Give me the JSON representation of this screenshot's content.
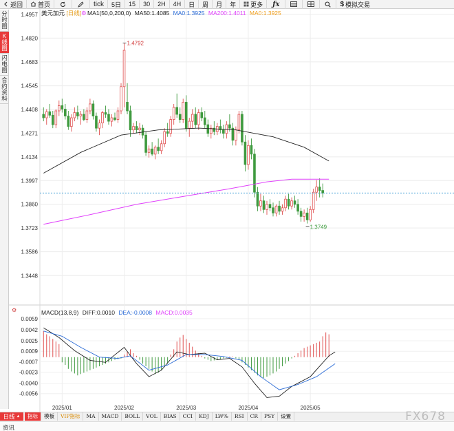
{
  "toolbar": {
    "items": [
      {
        "label": "返回",
        "icon": "back-arrow-icon"
      },
      {
        "label": "首页",
        "icon": "home-icon"
      },
      {
        "label": "",
        "icon": "refresh-icon"
      },
      {
        "label": "",
        "icon": "draw-pen-icon"
      },
      {
        "label": "tick"
      },
      {
        "label": "5日"
      },
      {
        "label": "15"
      },
      {
        "label": "30"
      },
      {
        "label": "2H"
      },
      {
        "label": "4H"
      },
      {
        "label": "日"
      },
      {
        "label": "周"
      },
      {
        "label": "月"
      },
      {
        "label": "年"
      },
      {
        "label": "更多",
        "icon": "grid-icon"
      },
      {
        "label": "",
        "icon": "function-fx-icon"
      },
      {
        "label": "",
        "icon": "list-icon"
      },
      {
        "label": "",
        "icon": "multi-window-icon"
      },
      {
        "label": "",
        "icon": "search-icon"
      },
      {
        "label": "模拟交易",
        "icon": "dollar-icon"
      }
    ]
  },
  "sidebar": {
    "tabs": [
      {
        "label": "分时图",
        "active": false
      },
      {
        "label": "K线图",
        "active": true
      },
      {
        "label": "闪电图",
        "active": false
      },
      {
        "label": "合约资料",
        "active": false
      }
    ]
  },
  "legend": {
    "symbol": "美元加元",
    "period": "[日线]",
    "ma_params": "MA1(50,0,200,0)",
    "ma50": "MA50:1.4085",
    "ma0a": "MA0:1.3925",
    "ma200": "MA200:1.4011",
    "ma0b": "MA0:1.3925",
    "colors": {
      "ma50": "#222222",
      "ma200": "#e040fb",
      "ma0a": "#2a6bd6",
      "ma0b": "#f0a020"
    }
  },
  "macd_legend": {
    "name": "MACD(13,8,9)",
    "diff": "DIFF:0.0010",
    "dea": "DEA:-0.0008",
    "macd": "MACD:0.0035",
    "colors": {
      "diff": "#222222",
      "dea": "#2a6bd6",
      "macd": "#e040fb"
    }
  },
  "annotations": {
    "high": "1.4792",
    "low": "1.3749"
  },
  "chart_data": {
    "type": "candlestick",
    "price_axis_ticks": [
      "1.4957",
      "1.4820",
      "1.4683",
      "1.4545",
      "1.4408",
      "1.4271",
      "1.4134",
      "1.3997",
      "1.3860",
      "1.3723",
      "1.3586",
      "1.3448"
    ],
    "price_range": [
      1.331,
      1.4957
    ],
    "current_price_line": 1.3925,
    "x_labels": [
      "2025/01",
      "2025/02",
      "2025/03",
      "2025/04",
      "2025/05"
    ],
    "x_label_positions": [
      6,
      26,
      46,
      66,
      86
    ],
    "n_bars": 98,
    "macd_axis_ticks": [
      "0.0059",
      "0.0042",
      "0.0025",
      "0.0009",
      "-0.0007",
      "-0.0023",
      "-0.0040",
      "-0.0056"
    ],
    "macd_range": [
      -0.007,
      0.0062
    ],
    "candles": [
      [
        1.438,
        1.442,
        1.434,
        1.436
      ],
      [
        1.436,
        1.441,
        1.432,
        1.4395
      ],
      [
        1.4395,
        1.444,
        1.436,
        1.4375
      ],
      [
        1.4375,
        1.44,
        1.43,
        1.432
      ],
      [
        1.432,
        1.441,
        1.43,
        1.44
      ],
      [
        1.44,
        1.446,
        1.437,
        1.443
      ],
      [
        1.443,
        1.447,
        1.439,
        1.441
      ],
      [
        1.441,
        1.444,
        1.435,
        1.437
      ],
      [
        1.437,
        1.44,
        1.429,
        1.431
      ],
      [
        1.431,
        1.438,
        1.428,
        1.436
      ],
      [
        1.436,
        1.442,
        1.434,
        1.439
      ],
      [
        1.439,
        1.443,
        1.435,
        1.437
      ],
      [
        1.437,
        1.44,
        1.432,
        1.438
      ],
      [
        1.438,
        1.441,
        1.434,
        1.435
      ],
      [
        1.435,
        1.442,
        1.433,
        1.44
      ],
      [
        1.44,
        1.447,
        1.438,
        1.444
      ],
      [
        1.444,
        1.446,
        1.435,
        1.437
      ],
      [
        1.437,
        1.439,
        1.428,
        1.43
      ],
      [
        1.43,
        1.435,
        1.426,
        1.433
      ],
      [
        1.433,
        1.44,
        1.43,
        1.439
      ],
      [
        1.439,
        1.443,
        1.436,
        1.438
      ],
      [
        1.438,
        1.441,
        1.432,
        1.434
      ],
      [
        1.434,
        1.438,
        1.431,
        1.436
      ],
      [
        1.436,
        1.439,
        1.434,
        1.435
      ],
      [
        1.435,
        1.442,
        1.433,
        1.44
      ],
      [
        1.44,
        1.456,
        1.438,
        1.454
      ],
      [
        1.454,
        1.4792,
        1.442,
        1.475
      ],
      [
        1.445,
        1.456,
        1.438,
        1.44
      ],
      [
        1.44,
        1.443,
        1.425,
        1.429
      ],
      [
        1.429,
        1.433,
        1.427,
        1.431
      ],
      [
        1.431,
        1.434,
        1.427,
        1.429
      ],
      [
        1.429,
        1.433,
        1.426,
        1.43
      ],
      [
        1.43,
        1.432,
        1.424,
        1.426
      ],
      [
        1.426,
        1.428,
        1.414,
        1.416
      ],
      [
        1.416,
        1.42,
        1.413,
        1.418
      ],
      [
        1.418,
        1.422,
        1.414,
        1.415
      ],
      [
        1.415,
        1.42,
        1.412,
        1.419
      ],
      [
        1.419,
        1.424,
        1.415,
        1.417
      ],
      [
        1.417,
        1.423,
        1.415,
        1.421
      ],
      [
        1.421,
        1.43,
        1.419,
        1.428
      ],
      [
        1.428,
        1.433,
        1.425,
        1.427
      ],
      [
        1.427,
        1.437,
        1.425,
        1.435
      ],
      [
        1.435,
        1.444,
        1.432,
        1.442
      ],
      [
        1.442,
        1.45,
        1.436,
        1.438
      ],
      [
        1.438,
        1.442,
        1.433,
        1.435
      ],
      [
        1.435,
        1.447,
        1.433,
        1.445
      ],
      [
        1.445,
        1.449,
        1.428,
        1.43
      ],
      [
        1.43,
        1.436,
        1.425,
        1.434
      ],
      [
        1.434,
        1.441,
        1.43,
        1.438
      ],
      [
        1.438,
        1.442,
        1.43,
        1.432
      ],
      [
        1.432,
        1.441,
        1.429,
        1.439
      ],
      [
        1.439,
        1.442,
        1.434,
        1.436
      ],
      [
        1.436,
        1.44,
        1.43,
        1.432
      ],
      [
        1.432,
        1.435,
        1.425,
        1.427
      ],
      [
        1.427,
        1.432,
        1.424,
        1.43
      ],
      [
        1.43,
        1.434,
        1.426,
        1.428
      ],
      [
        1.428,
        1.433,
        1.426,
        1.431
      ],
      [
        1.431,
        1.435,
        1.427,
        1.429
      ],
      [
        1.429,
        1.432,
        1.424,
        1.427
      ],
      [
        1.427,
        1.434,
        1.424,
        1.432
      ],
      [
        1.432,
        1.438,
        1.428,
        1.43
      ],
      [
        1.43,
        1.433,
        1.42,
        1.423
      ],
      [
        1.423,
        1.431,
        1.42,
        1.429
      ],
      [
        1.429,
        1.44,
        1.427,
        1.438
      ],
      [
        1.438,
        1.44,
        1.42,
        1.422
      ],
      [
        1.422,
        1.426,
        1.405,
        1.409
      ],
      [
        1.409,
        1.423,
        1.406,
        1.42
      ],
      [
        1.42,
        1.424,
        1.412,
        1.415
      ],
      [
        1.415,
        1.418,
        1.39,
        1.393
      ],
      [
        1.393,
        1.396,
        1.382,
        1.385
      ],
      [
        1.385,
        1.392,
        1.382,
        1.388
      ],
      [
        1.388,
        1.391,
        1.381,
        1.383
      ],
      [
        1.383,
        1.388,
        1.38,
        1.386
      ],
      [
        1.386,
        1.389,
        1.382,
        1.384
      ],
      [
        1.384,
        1.387,
        1.379,
        1.381
      ],
      [
        1.381,
        1.386,
        1.379,
        1.385
      ],
      [
        1.385,
        1.388,
        1.38,
        1.382
      ],
      [
        1.382,
        1.386,
        1.38,
        1.384
      ],
      [
        1.384,
        1.391,
        1.382,
        1.389
      ],
      [
        1.389,
        1.392,
        1.383,
        1.385
      ],
      [
        1.385,
        1.39,
        1.383,
        1.388
      ],
      [
        1.388,
        1.391,
        1.384,
        1.386
      ],
      [
        1.386,
        1.389,
        1.38,
        1.382
      ],
      [
        1.382,
        1.384,
        1.376,
        1.379
      ],
      [
        1.379,
        1.383,
        1.376,
        1.381
      ],
      [
        1.381,
        1.384,
        1.3749,
        1.377
      ],
      [
        1.377,
        1.385,
        1.376,
        1.383
      ],
      [
        1.383,
        1.395,
        1.381,
        1.393
      ],
      [
        1.393,
        1.4,
        1.388,
        1.396
      ],
      [
        1.396,
        1.401,
        1.39,
        1.394
      ],
      [
        1.394,
        1.398,
        1.39,
        1.3925
      ]
    ],
    "ma50_points": [
      [
        0,
        1.404
      ],
      [
        12,
        1.416
      ],
      [
        25,
        1.426
      ],
      [
        37,
        1.429
      ],
      [
        50,
        1.43
      ],
      [
        62,
        1.429
      ],
      [
        74,
        1.425
      ],
      [
        84,
        1.419
      ],
      [
        92,
        1.411
      ]
    ],
    "ma200_points": [
      [
        0,
        1.3745
      ],
      [
        15,
        1.38
      ],
      [
        30,
        1.386
      ],
      [
        45,
        1.3905
      ],
      [
        60,
        1.395
      ],
      [
        72,
        1.399
      ],
      [
        80,
        1.4005
      ],
      [
        92,
        1.4005
      ]
    ],
    "macd_hist": [
      0.004,
      0.0035,
      0.0032,
      0.0028,
      0.0024,
      0.002,
      -0.0008,
      -0.0012,
      -0.0018,
      -0.0022,
      -0.0025,
      -0.0028,
      -0.0026,
      -0.0024,
      -0.0022,
      -0.002,
      -0.0018,
      -0.0016,
      -0.0014,
      -0.0012,
      -0.001,
      -0.0008,
      -0.0006,
      -0.0004,
      -0.0003,
      -0.0002,
      0.0004,
      0.0008,
      0.0012,
      0.0006,
      0.0002,
      -0.0004,
      -0.001,
      -0.0014,
      -0.0018,
      -0.0022,
      -0.0026,
      -0.0024,
      -0.002,
      -0.0015,
      -0.001,
      0.0004,
      0.0012,
      0.0024,
      0.003,
      0.0034,
      0.0028,
      0.0022,
      0.0016,
      0.001,
      0.0006,
      0.0002,
      -0.0002,
      -0.0004,
      -0.0006,
      -0.0005,
      -0.0004,
      -0.0003,
      -0.0002,
      -0.0001,
      0.0001,
      0.0001,
      -0.0002,
      -0.0004,
      -0.0008,
      -0.0012,
      -0.0016,
      -0.002,
      -0.0024,
      -0.0028,
      -0.003,
      -0.0032,
      -0.003,
      -0.0028,
      -0.0025,
      -0.0022,
      -0.0018,
      -0.0014,
      -0.001,
      -0.0006,
      -0.0002,
      0.0002,
      0.0006,
      0.001,
      0.0014,
      0.0016,
      0.0018,
      0.002,
      0.0022,
      0.0024,
      0.0032,
      0.0038,
      0.0035
    ],
    "diff_points": [
      [
        0,
        0.0045
      ],
      [
        5,
        0.003
      ],
      [
        10,
        0.001
      ],
      [
        15,
        -0.0005
      ],
      [
        20,
        -0.0008
      ],
      [
        26,
        0.0015
      ],
      [
        30,
        -0.001
      ],
      [
        34,
        -0.003
      ],
      [
        38,
        -0.002
      ],
      [
        43,
        0.0008
      ],
      [
        47,
        0.0004
      ],
      [
        52,
        0.0006
      ],
      [
        56,
        -0.0004
      ],
      [
        60,
        -0.0002
      ],
      [
        64,
        -0.0015
      ],
      [
        68,
        -0.004
      ],
      [
        72,
        -0.0062
      ],
      [
        76,
        -0.006
      ],
      [
        80,
        -0.0045
      ],
      [
        86,
        -0.003
      ],
      [
        92,
        0.0002
      ],
      [
        94,
        0.0008
      ]
    ],
    "dea_points": [
      [
        0,
        0.004
      ],
      [
        6,
        0.0032
      ],
      [
        12,
        0.0015
      ],
      [
        18,
        0.0
      ],
      [
        24,
        -0.0002
      ],
      [
        28,
        0.0002
      ],
      [
        34,
        -0.002
      ],
      [
        40,
        -0.0012
      ],
      [
        46,
        0.0004
      ],
      [
        52,
        0.0004
      ],
      [
        58,
        0.0001
      ],
      [
        64,
        -0.0005
      ],
      [
        70,
        -0.003
      ],
      [
        76,
        -0.005
      ],
      [
        82,
        -0.0042
      ],
      [
        88,
        -0.003
      ],
      [
        94,
        -0.001
      ]
    ]
  },
  "bottom_bar": {
    "period": "日线",
    "period_arrow": "▲",
    "indicators": [
      {
        "label": "指标",
        "active": true,
        "vip": false
      },
      {
        "label": "模板",
        "active": false,
        "vip": false
      },
      {
        "label": "VIP指标",
        "active": false,
        "vip": true
      },
      {
        "label": "MA",
        "active": false,
        "vip": false
      },
      {
        "label": "MACD",
        "active": false,
        "vip": false
      },
      {
        "label": "BOLL",
        "active": false,
        "vip": false
      },
      {
        "label": "VOL",
        "active": false,
        "vip": false
      },
      {
        "label": "BIAS",
        "active": false,
        "vip": false
      },
      {
        "label": "CCI",
        "active": false,
        "vip": false
      },
      {
        "label": "KDJ",
        "active": false,
        "vip": false
      },
      {
        "label": "LW%",
        "active": false,
        "vip": false
      },
      {
        "label": "RSI",
        "active": false,
        "vip": false
      },
      {
        "label": "CR",
        "active": false,
        "vip": false
      },
      {
        "label": "PSY",
        "active": false,
        "vip": false
      },
      {
        "label": "设置",
        "active": false,
        "vip": false
      }
    ]
  },
  "footer": {
    "label": "资讯"
  },
  "watermark": "FX678"
}
